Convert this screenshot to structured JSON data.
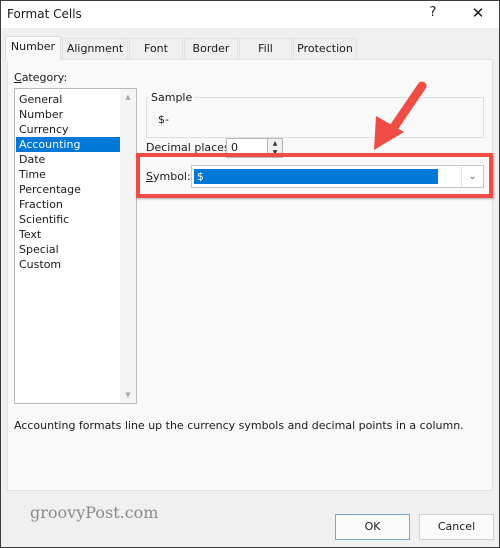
{
  "window": {
    "title": "Format Cells",
    "help_label": "?",
    "close_label": "✕"
  },
  "tabs": [
    {
      "label": "Number",
      "active": true
    },
    {
      "label": "Alignment",
      "active": false
    },
    {
      "label": "Font",
      "active": false
    },
    {
      "label": "Border",
      "active": false
    },
    {
      "label": "Fill",
      "active": false
    },
    {
      "label": "Protection",
      "active": false
    }
  ],
  "category": {
    "label_accel": "C",
    "label_rest": "ategory:",
    "items": [
      "General",
      "Number",
      "Currency",
      "Accounting",
      "Date",
      "Time",
      "Percentage",
      "Fraction",
      "Scientific",
      "Text",
      "Special",
      "Custom"
    ],
    "selected": "Accounting",
    "scroll_up_icon": "▲",
    "scroll_down_icon": "▼"
  },
  "sample": {
    "legend": "Sample",
    "value": "$-"
  },
  "decimal_places": {
    "label_pre": "Decimal places:",
    "value": "0",
    "up_icon": "▲",
    "down_icon": "▼"
  },
  "symbol": {
    "label_accel": "S",
    "label_rest": "ymbol:",
    "value": "$",
    "dropdown_icon": "⌄"
  },
  "description": "Accounting formats line up the currency symbols and decimal points in a column.",
  "watermark": "groovyPost.com",
  "buttons": {
    "ok": "OK",
    "cancel": "Cancel"
  },
  "colors": {
    "selection": "#0078d7",
    "annotation": "#ef4c45"
  }
}
